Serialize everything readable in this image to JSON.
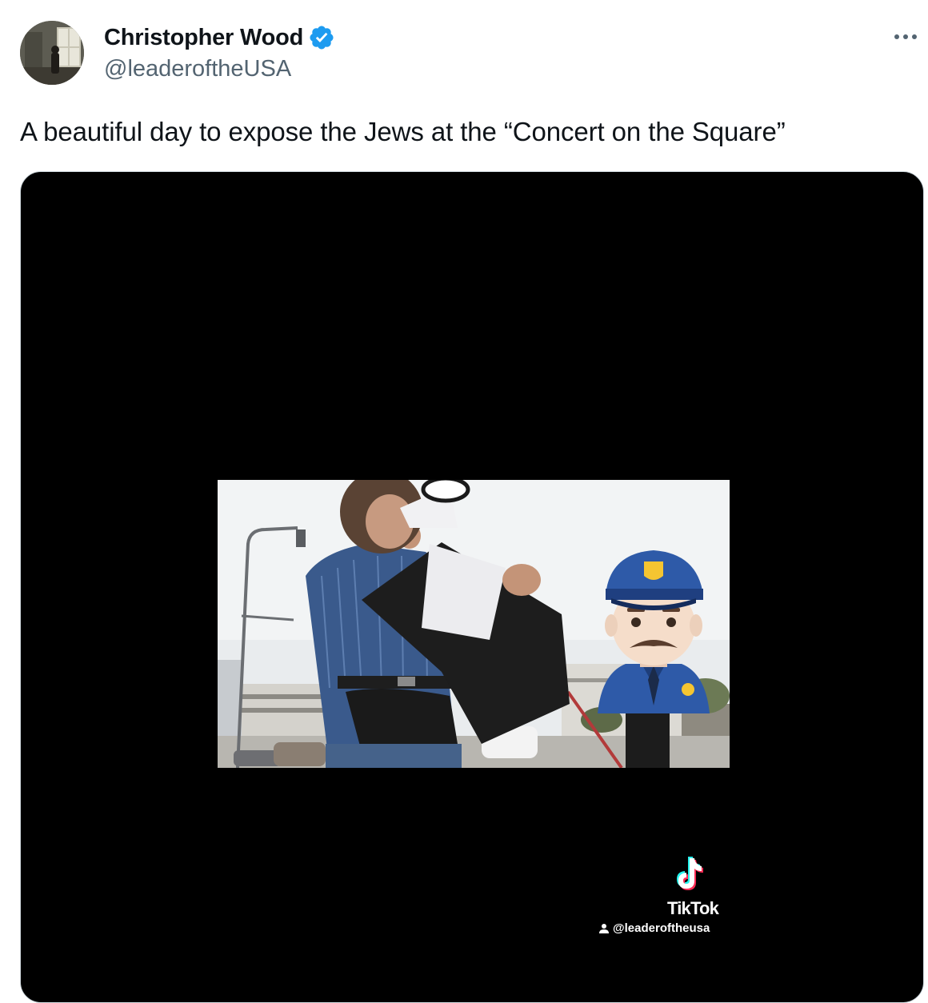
{
  "tweet": {
    "author": {
      "display_name": "Christopher Wood",
      "handle": "@leaderoftheUSA",
      "verified": true,
      "verified_color": "#1d9bf0"
    },
    "more_icon": "more-horizontal-icon",
    "text": "A beautiful day to expose the Jews at the “Concert on the Square”"
  },
  "media": {
    "type": "video",
    "watermark": {
      "brand": "TikTok",
      "handle": "@leaderoftheusa",
      "icon": "tiktok-logo-icon"
    },
    "overlay_emoji": "police-officer-emoji"
  },
  "colors": {
    "text_primary": "#0f1419",
    "text_secondary": "#536471",
    "border": "#cfd9de",
    "media_background": "#000000"
  }
}
